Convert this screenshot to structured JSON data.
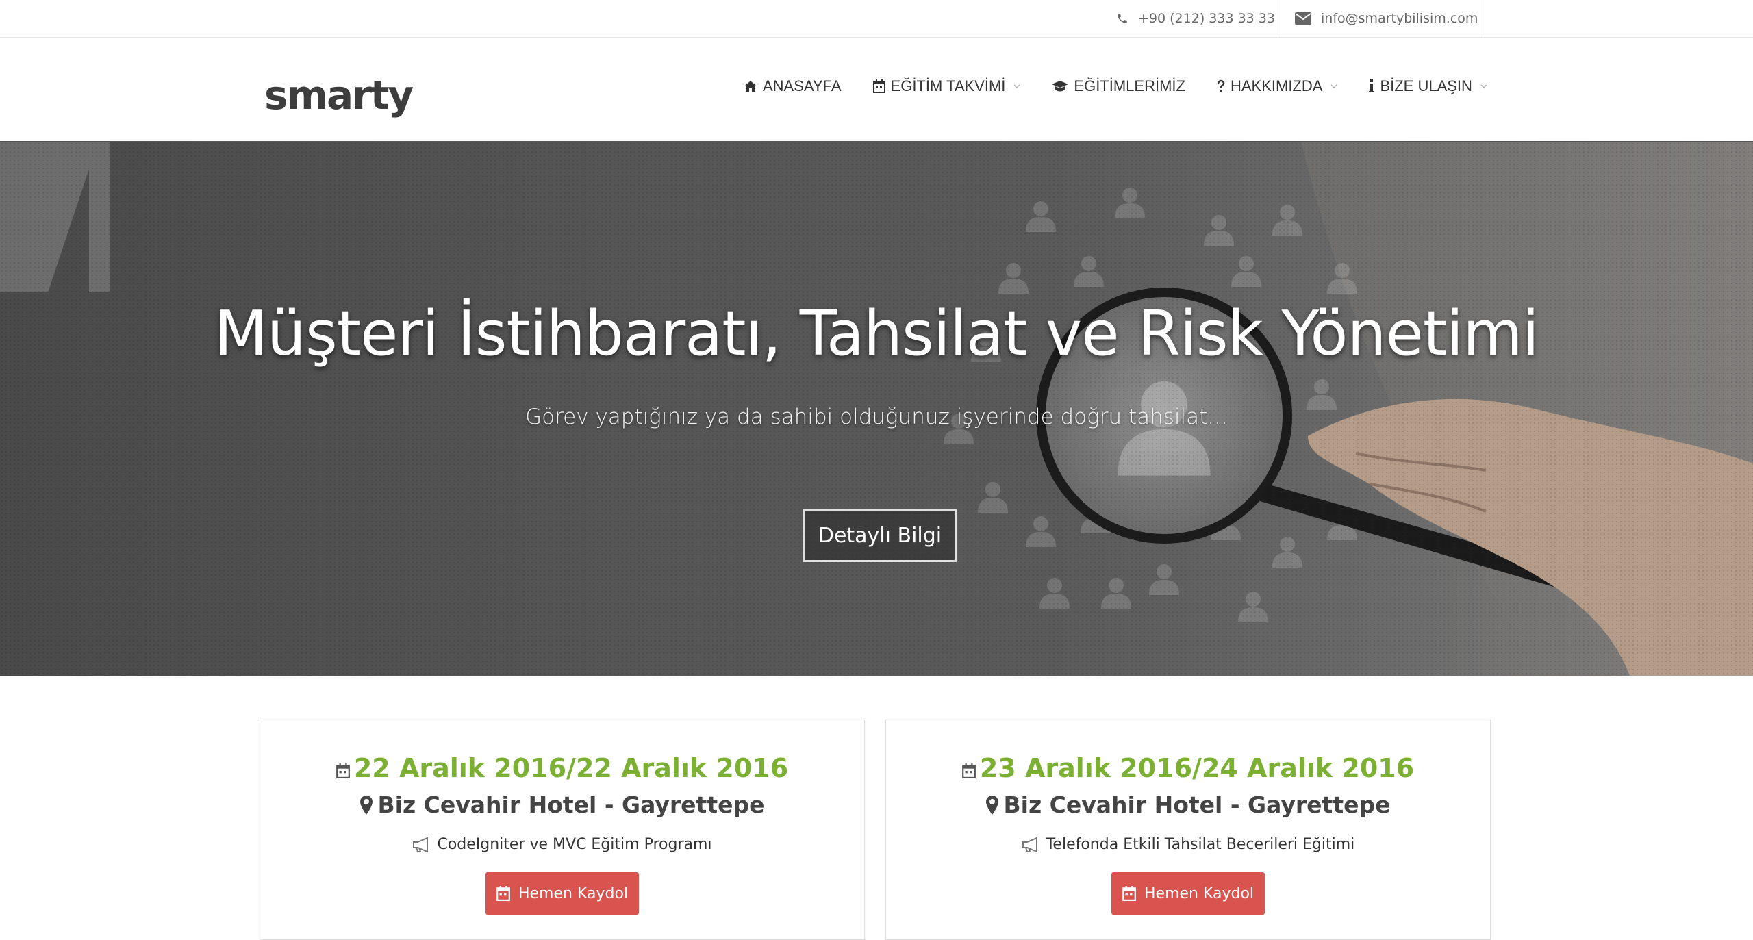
{
  "topbar": {
    "phone": "+90 (212) 333 33 33",
    "email": "info@smartybilisim.com"
  },
  "header": {
    "logo": "smarty",
    "nav": [
      {
        "label": "ANASAYFA",
        "icon": "home-icon",
        "dropdown": false
      },
      {
        "label": "EĞİTİM TAKVİMİ",
        "icon": "calendar-icon",
        "dropdown": true
      },
      {
        "label": "EĞİTİMLERİMİZ",
        "icon": "graduation-cap-icon",
        "dropdown": false
      },
      {
        "label": "HAKKIMIZDA",
        "icon": "question-icon",
        "dropdown": true
      },
      {
        "label": "BİZE ULAŞIN",
        "icon": "info-icon",
        "dropdown": true
      }
    ]
  },
  "hero": {
    "title": "Müşteri İstihbaratı, Tahsilat ve Risk Yönetimi",
    "subtitle": "Görev yaptığınız ya da sahibi olduğunuz işyerinde doğru tahsilat...",
    "button": "Detaylı Bilgi"
  },
  "cards": [
    {
      "date": "22 Aralık 2016/22 Aralık 2016",
      "location": "Biz Cevahir Hotel - Gayrettepe",
      "program": "CodeIgniter ve MVC Eğitim Programı",
      "button": "Hemen Kaydol"
    },
    {
      "date": "23 Aralık 2016/24 Aralık 2016",
      "location": "Biz Cevahir Hotel - Gayrettepe",
      "program": "Telefonda Etkili Tahsilat Becerileri Eğitimi",
      "button": "Hemen Kaydol"
    }
  ],
  "colors": {
    "accent_green": "#7cb033",
    "button_red": "#d9534f"
  }
}
